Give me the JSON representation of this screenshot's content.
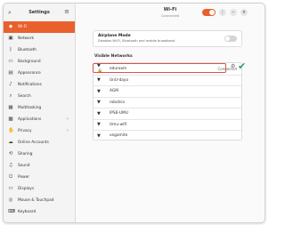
{
  "sidebar": {
    "title": "Settings",
    "search_icon": "search-icon",
    "menu_icon": "hamburger-icon",
    "items": [
      {
        "label": "Wi-Fi",
        "icon": "wifi-icon",
        "glyph": "◆",
        "active": true,
        "chevron": false
      },
      {
        "label": "Network",
        "icon": "network-icon",
        "glyph": "▣",
        "active": false,
        "chevron": false
      },
      {
        "label": "Bluetooth",
        "icon": "bluetooth-icon",
        "glyph": "ᛒ",
        "active": false,
        "chevron": false
      },
      {
        "label": "Background",
        "icon": "background-icon",
        "glyph": "▭",
        "active": false,
        "chevron": false
      },
      {
        "label": "Appearance",
        "icon": "appearance-icon",
        "glyph": "▤",
        "active": false,
        "chevron": false
      },
      {
        "label": "Notifications",
        "icon": "bell-icon",
        "glyph": "♪",
        "active": false,
        "chevron": false
      },
      {
        "label": "Search",
        "icon": "search-icon",
        "glyph": "⌕",
        "active": false,
        "chevron": false
      },
      {
        "label": "Multitasking",
        "icon": "multitasking-icon",
        "glyph": "▦",
        "active": false,
        "chevron": false
      },
      {
        "label": "Applications",
        "icon": "applications-icon",
        "glyph": "▩",
        "active": false,
        "chevron": true
      },
      {
        "label": "Privacy",
        "icon": "privacy-icon",
        "glyph": "✋",
        "active": false,
        "chevron": true
      },
      {
        "label": "Online Accounts",
        "icon": "cloud-icon",
        "glyph": "☁",
        "active": false,
        "chevron": false
      },
      {
        "label": "Sharing",
        "icon": "share-icon",
        "glyph": "⟲",
        "active": false,
        "chevron": false
      },
      {
        "label": "Sound",
        "icon": "speaker-icon",
        "glyph": "♫",
        "active": false,
        "chevron": false
      },
      {
        "label": "Power",
        "icon": "power-icon",
        "glyph": "⏻",
        "active": false,
        "chevron": false
      },
      {
        "label": "Displays",
        "icon": "display-icon",
        "glyph": "▭",
        "active": false,
        "chevron": false
      },
      {
        "label": "Mouse & Touchpad",
        "icon": "mouse-icon",
        "glyph": "◎",
        "active": false,
        "chevron": false
      },
      {
        "label": "Keyboard",
        "icon": "keyboard-icon",
        "glyph": "⌨",
        "active": false,
        "chevron": false
      }
    ]
  },
  "header": {
    "title": "Wi-Fi",
    "subtitle": "Connected",
    "wifi_enabled": true,
    "more_icon": "more-icon",
    "minimize_icon": "minimize-icon",
    "close_icon": "close-icon",
    "more_glyph": "⋮",
    "minimize_glyph": "–",
    "close_glyph": "×"
  },
  "airplane": {
    "title": "Airplane Mode",
    "description": "Disables Wi-Fi, Bluetooth and mobile broadband",
    "enabled": false
  },
  "visible_networks": {
    "label": "Visible Networks",
    "networks": [
      {
        "name": "eduroam",
        "status": "Connected",
        "secured": true
      },
      {
        "name": "UnU-dayo",
        "status": "",
        "secured": false
      },
      {
        "name": "AGM",
        "status": "",
        "secured": false
      },
      {
        "name": "robotics",
        "status": "",
        "secured": false
      },
      {
        "name": "IPS6-UMU",
        "status": "",
        "secured": false
      },
      {
        "name": "Umu-wifi",
        "status": "",
        "secured": false
      },
      {
        "name": "vegamite",
        "status": "",
        "secured": false
      }
    ]
  },
  "colors": {
    "accent": "#e9602d",
    "highlight_border": "#d9534f",
    "checkmark": "#26a269"
  }
}
